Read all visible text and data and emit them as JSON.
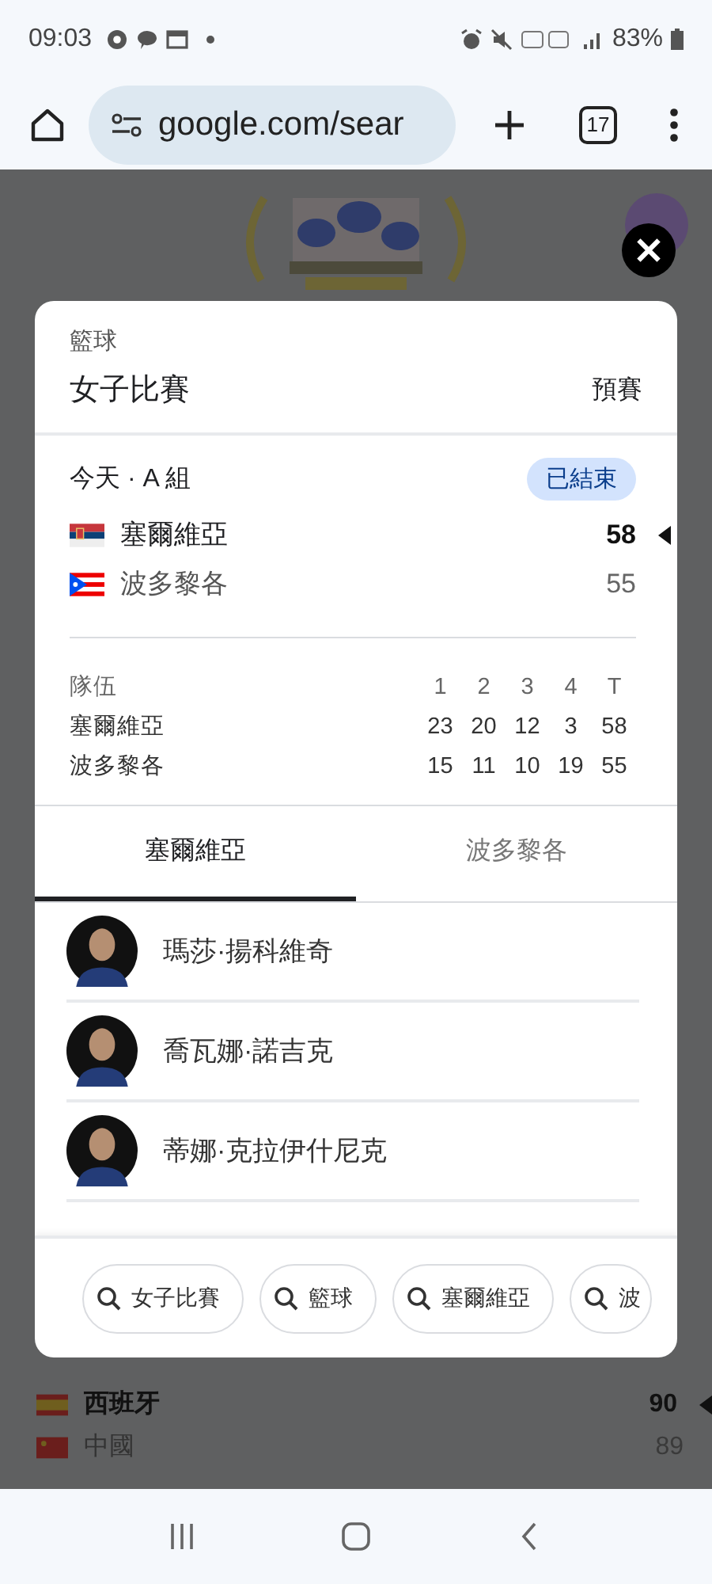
{
  "status_bar": {
    "time": "09:03",
    "battery": "83%"
  },
  "browser": {
    "url": "google.com/sear",
    "tab_count": "17"
  },
  "background": {
    "rows": [
      {
        "kind": "es",
        "name": "西班牙",
        "score": "90",
        "winner": true
      },
      {
        "kind": "cn",
        "name": "中國",
        "score": "89",
        "winner": false
      }
    ]
  },
  "card": {
    "sport": "籃球",
    "title": "女子比賽",
    "stage": "預賽",
    "group": "今天 · A 組",
    "status": "已結束",
    "teams": [
      {
        "kind": "rs",
        "name": "塞爾維亞",
        "score": "58",
        "winner": true
      },
      {
        "kind": "pr",
        "name": "波多黎各",
        "score": "55",
        "winner": false
      }
    ],
    "box_score": {
      "columns": [
        "隊伍",
        "1",
        "2",
        "3",
        "4",
        "T"
      ],
      "rows": [
        [
          "塞爾維亞",
          "23",
          "20",
          "12",
          "3",
          "58"
        ],
        [
          "波多黎各",
          "15",
          "11",
          "10",
          "19",
          "55"
        ]
      ]
    },
    "tabs": [
      {
        "label": "塞爾維亞",
        "selected": true
      },
      {
        "label": "波多黎各",
        "selected": false
      }
    ],
    "players": [
      {
        "name": "瑪莎·揚科維奇"
      },
      {
        "name": "喬瓦娜·諾吉克"
      },
      {
        "name": "蒂娜·克拉伊什尼克"
      }
    ],
    "chips": [
      "女子比賽",
      "籃球",
      "塞爾維亞",
      "波"
    ]
  }
}
